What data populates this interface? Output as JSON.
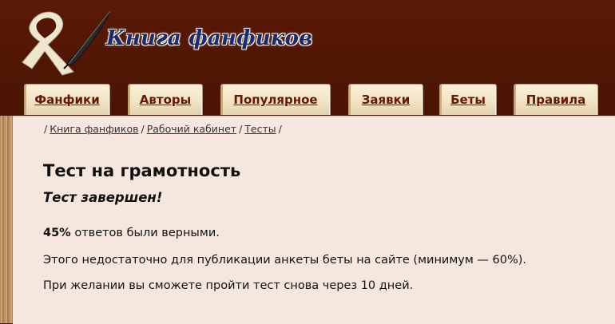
{
  "header": {
    "logo_text": "Книга фанфиков",
    "logo_icon": "quill-and-ribbon"
  },
  "nav": {
    "tabs": [
      {
        "label": "Фанфики"
      },
      {
        "label": "Авторы"
      },
      {
        "label": "Популярное"
      },
      {
        "label": "Заявки"
      },
      {
        "label": "Беты"
      },
      {
        "label": "Правила"
      }
    ]
  },
  "breadcrumb": {
    "items": [
      {
        "label": "Книга фанфиков"
      },
      {
        "label": "Рабочий кабинет"
      },
      {
        "label": "Тесты"
      }
    ]
  },
  "main": {
    "title": "Тест на грамотность",
    "subtitle": "Тест завершен!",
    "score": "45%",
    "score_text": "ответов были верными.",
    "message": "Этого недостаточно для публикации анкеты беты на сайте (минимум — 60%).",
    "retry": "При желании вы сможете пройти тест снова через 10 дней."
  },
  "colors": {
    "header_bg": "#511704",
    "tab_text": "#6b1508",
    "logo_text": "#1c2a6e",
    "content_bg": "#f5e7de"
  }
}
